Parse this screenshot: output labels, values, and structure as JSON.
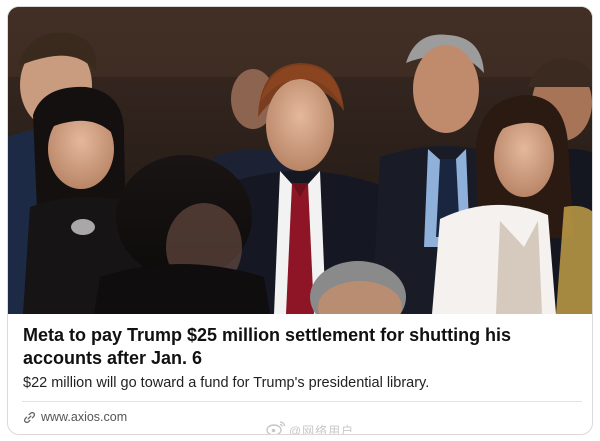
{
  "article": {
    "headline": "Meta to pay Trump $25 million settlement for shutting his accounts after Jan. 6",
    "subhead": "$22 million will go toward a fund for Trump's presidential library.",
    "source": "www.axios.com",
    "image_alt": "Photo of a crowd of people in formal attire at an indoor event"
  },
  "icons": {
    "source_icon": "link-icon",
    "watermark_icon": "weibo-logo-icon"
  },
  "watermark": {
    "text": "@网络用户"
  },
  "colors": {
    "headline": "#111111",
    "subhead": "#222222",
    "source": "#555555",
    "card_border": "#d9d9d9",
    "tie": "#8e1525"
  }
}
